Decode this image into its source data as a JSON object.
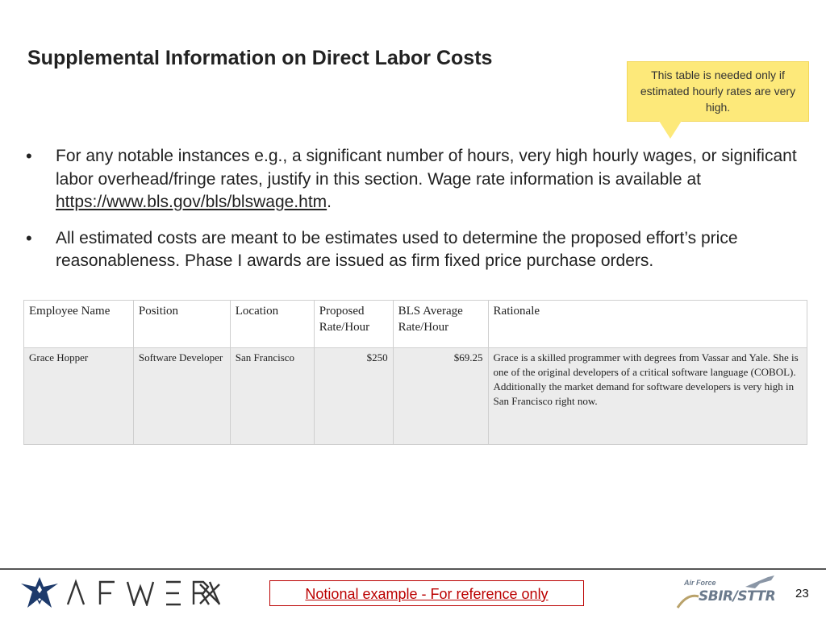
{
  "slide": {
    "title": "Supplemental Information on Direct Labor Costs",
    "callout": "This table is needed only if estimated hourly rates are very high.",
    "bullets": [
      {
        "text_before": "For any notable instances e.g., a significant number of hours, very high hourly wages, or significant labor overhead/fringe rates, justify in this section. Wage rate information is available at  ",
        "link": "https://www.bls.gov/bls/blswage.htm",
        "text_after": "."
      },
      {
        "text_before": "All estimated costs are meant to be estimates used to determine the proposed effort’s price reasonableness.  Phase I awards are issued as firm fixed price purchase orders.",
        "link": "",
        "text_after": ""
      }
    ]
  },
  "table": {
    "headers": [
      "Employee Name",
      "Position",
      "Location",
      "Proposed Rate/Hour",
      "BLS Average Rate/Hour",
      "Rationale"
    ],
    "rows": [
      {
        "employee": "Grace Hopper",
        "position": "Software Developer",
        "location": "San Francisco",
        "proposed_rate": "$250",
        "bls_rate": "$69.25",
        "rationale": "Grace is a skilled programmer with degrees from Vassar and Yale.  She is one of the original developers of a critical software language (COBOL).  Additionally the market demand for software developers is very high in San Francisco right now."
      }
    ]
  },
  "footer": {
    "brand": "AFWERX",
    "notional": "Notional example - For reference only",
    "sbir_top": "Air Force",
    "sbir_text": "SBIR/STTR",
    "page_number": "23"
  },
  "colors": {
    "callout_bg": "#fde97a",
    "notional_red": "#bb0000",
    "table_row_bg": "#ececec"
  },
  "icons": [
    "air-force-wings-logo",
    "afwerx-wordmark",
    "sbir-sttr-logo"
  ]
}
